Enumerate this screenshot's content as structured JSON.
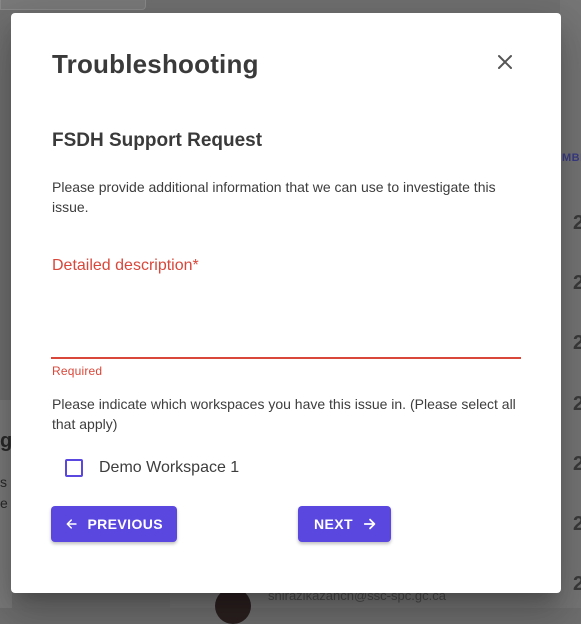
{
  "dialog": {
    "title": "Troubleshooting",
    "close_icon": "close-icon",
    "section_title": "FSDH Support Request",
    "helper_text": "Please provide additional information that we can use to investigate this issue.",
    "description_field": {
      "label": "Detailed description*",
      "value": "",
      "error": "Required"
    },
    "workspace_question": "Please indicate which workspaces you have this issue in. (Please select all that apply)",
    "workspaces": [
      {
        "label": "Demo Workspace 1",
        "checked": false
      }
    ],
    "buttons": {
      "previous_label": "PREVIOUS",
      "previous_icon": "arrow-left-icon",
      "next_label": "NEXT",
      "next_icon": "arrow-right-icon"
    }
  },
  "background": {
    "right_heading_fragment": "MBE",
    "right_numbers": [
      "2",
      "2",
      "2",
      "2",
      "2",
      "2",
      "2",
      "2"
    ],
    "left_fragments": [
      "ge",
      "s f",
      "e c"
    ],
    "email_fragment": "shirazikazanch@ssc-spc.gc.ca"
  },
  "colors": {
    "primary": "#5a47e0",
    "error": "#d9473a",
    "text": "#3a3a3a"
  }
}
